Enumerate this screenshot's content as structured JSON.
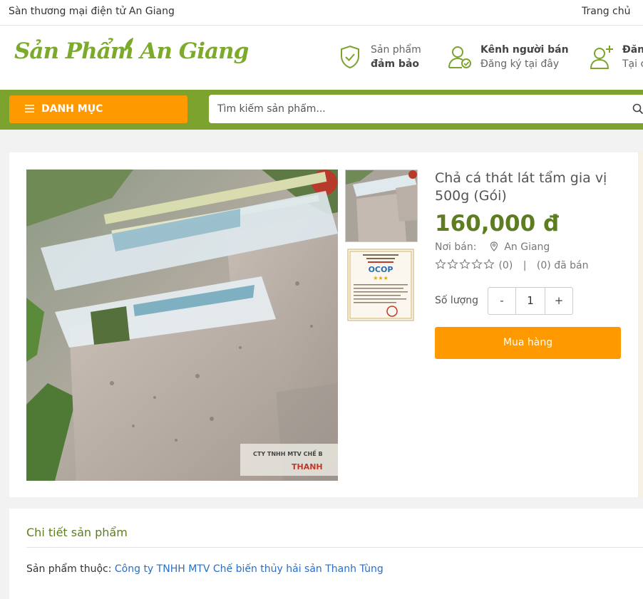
{
  "topbar": {
    "site_name": "Sàn thương mại điện tử An Giang",
    "home_link": "Trang chủ"
  },
  "header": {
    "logo_text": "Sản Phẩm An Giang",
    "features": [
      {
        "line1": "Sản phẩm",
        "line2": "đảm bảo",
        "icon": "shield-check-icon"
      },
      {
        "line1": "Kênh người bán",
        "line2": "Đăng ký tại đây",
        "icon": "user-check-icon"
      },
      {
        "line1": "Đăn",
        "line2": "Tại c",
        "icon": "user-plus-icon"
      }
    ]
  },
  "nav": {
    "menu_label": "DANH MỤC",
    "search_placeholder": "Tìm kiếm sản phẩm..."
  },
  "product": {
    "title": "Chả cá thát lát tẩm gia vị 500g (Gói)",
    "price": "160,000 đ",
    "seller_label": "Nơi bán:",
    "seller_location": "An Giang",
    "rating_stars": 0,
    "rating_count": "(0)",
    "separator": "|",
    "sold_text": "(0) đã bán",
    "quantity_label": "Số lượng",
    "quantity_value": "1",
    "minus_label": "-",
    "plus_label": "+",
    "buy_label": "Mua hàng",
    "image_labels": {
      "pack_line1": "CTY TNHH MTV CHẾ B",
      "pack_line2": "THANH",
      "certificate_badge": "OCOP"
    }
  },
  "details": {
    "heading": "Chi tiết sản phẩm",
    "belongs_label": "Sản phẩm thuộc:",
    "company_link": "Công ty TNHH MTV Chế biến thủy hải sản Thanh Tùng"
  },
  "colors": {
    "brand_green": "#7ca32e",
    "price_green": "#5e7d22",
    "accent_orange": "#ff9900",
    "link_blue": "#2a6fc6"
  }
}
